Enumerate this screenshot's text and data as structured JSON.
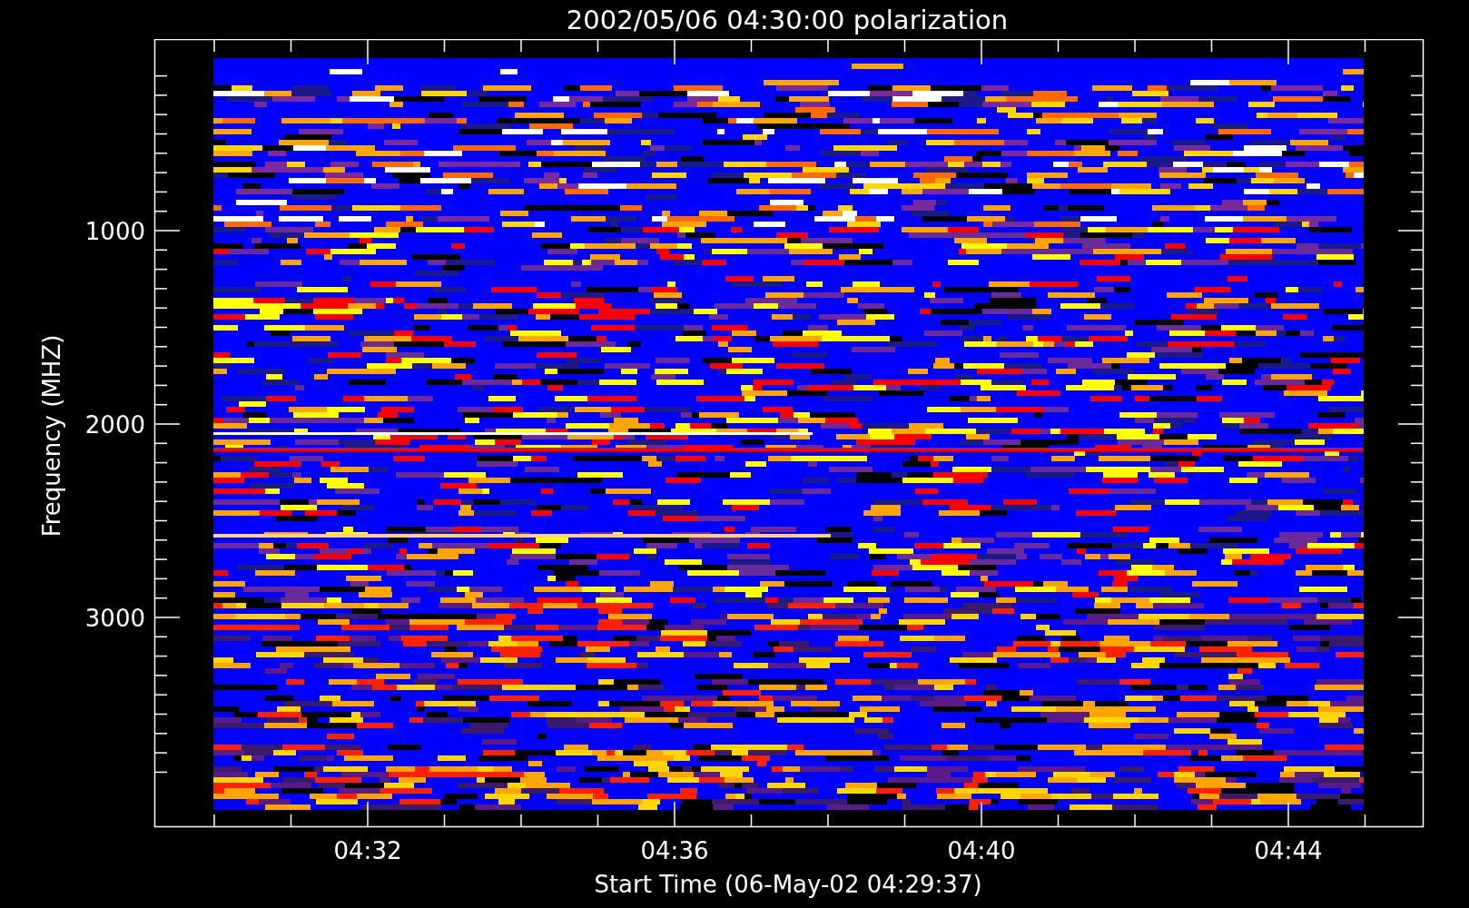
{
  "title": "2002/05/06 04:30:00 polarization",
  "y_axis": {
    "label": "Frequency (MHZ)",
    "ticks": [
      "1000",
      "2000",
      "3000"
    ]
  },
  "x_axis": {
    "label": "Start Time (06-May-02 04:29:37)",
    "ticks": [
      "04:32",
      "04:36",
      "04:40",
      "04:44"
    ]
  }
}
